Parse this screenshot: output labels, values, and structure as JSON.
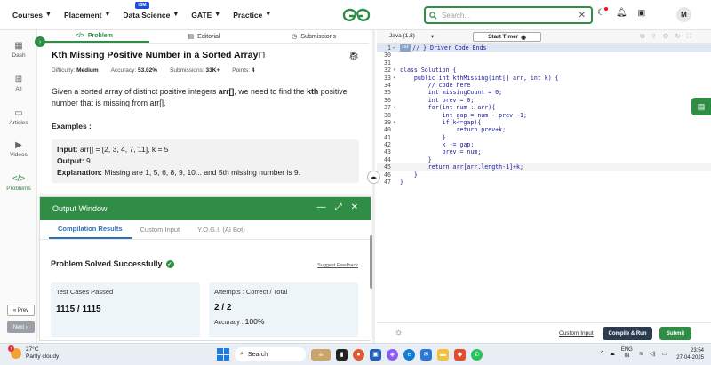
{
  "nav": {
    "items": [
      {
        "label": "Courses"
      },
      {
        "label": "Placement"
      },
      {
        "label": "Data Science",
        "badge": "IBM"
      },
      {
        "label": "GATE"
      },
      {
        "label": "Practice"
      }
    ],
    "search_placeholder": "Search...",
    "avatar_letter": "M",
    "brand_color": "#2f8d46"
  },
  "rail": {
    "items": [
      {
        "label": "Dash"
      },
      {
        "label": "All"
      },
      {
        "label": "Articles"
      },
      {
        "label": "Videos"
      },
      {
        "label": "Problems"
      }
    ],
    "prev": "« Prev",
    "next": "Next »"
  },
  "problem_tabs": {
    "problem": "Problem",
    "editorial": "Editorial",
    "submissions": "Submissions"
  },
  "problem": {
    "title": "Kth Missing Positive Number in a Sorted Array",
    "difficulty_label": "Difficulty:",
    "difficulty": "Medium",
    "accuracy_label": "Accuracy:",
    "accuracy": "53.02%",
    "submissions_label": "Submissions:",
    "submissions": "33K+",
    "points_label": "Points:",
    "points": "4",
    "desc_pre": "Given a sorted array of distinct positive integers ",
    "desc_arr": "arr[]",
    "desc_mid": ", we need to find the ",
    "desc_k": "kth",
    "desc_post": " positive number that is missing from arr[].",
    "examples_heading": "Examples :",
    "example": {
      "input_label": "Input:",
      "input": " arr[] = [2, 3, 4, 7, 11], k = 5",
      "output_label": "Output:",
      "output": " 9",
      "explanation_label": "Explanation:",
      "explanation": " Missing are 1, 5, 6, 8, 9, 10... and 5th missing number is 9."
    }
  },
  "output_window": {
    "title": "Output Window",
    "tabs": [
      "Compilation Results",
      "Custom Input",
      "Y.O.G.I. (AI Bot)"
    ],
    "status": "Problem Solved Successfully",
    "support": "Suggest Feedback",
    "test_cases_label": "Test Cases Passed",
    "test_cases": "1115 / 1115",
    "attempts_label": "Attempts : Correct / Total",
    "attempts": "2 / 2",
    "accuracy_label": "Accuracy :",
    "accuracy": "100%"
  },
  "editor": {
    "language": "Java (1.8)",
    "timer": "Start Timer",
    "lines": [
      {
        "n": "1",
        "fold": "▸",
        "text": "// } Driver Code Ends",
        "cls": "hl",
        "comment": true,
        "tag": "cmt"
      },
      {
        "n": "30",
        "fold": "",
        "text": ""
      },
      {
        "n": "31",
        "fold": "",
        "text": ""
      },
      {
        "n": "32",
        "fold": "▾",
        "text": "class Solution {"
      },
      {
        "n": "33",
        "fold": "▾",
        "text": "    public int kthMissing(int[] arr, int k) {"
      },
      {
        "n": "34",
        "fold": "",
        "text": "        // code here",
        "comment": true
      },
      {
        "n": "35",
        "fold": "",
        "text": "        int missingCount = 0;"
      },
      {
        "n": "36",
        "fold": "",
        "text": "        int prev = 0;"
      },
      {
        "n": "37",
        "fold": "▾",
        "text": "        for(int num : arr){"
      },
      {
        "n": "38",
        "fold": "",
        "text": "            int gap = num - prev -1;"
      },
      {
        "n": "39",
        "fold": "▾",
        "text": "            if(k<=gap){"
      },
      {
        "n": "40",
        "fold": "",
        "text": "                return prev+k;"
      },
      {
        "n": "41",
        "fold": "",
        "text": "            }"
      },
      {
        "n": "42",
        "fold": "",
        "text": "            k -= gap;"
      },
      {
        "n": "43",
        "fold": "",
        "text": "            prev = num;"
      },
      {
        "n": "44",
        "fold": "",
        "text": "        }"
      },
      {
        "n": "45",
        "fold": "",
        "text": "        return arr[arr.length-1]+k;",
        "cls": "hl2"
      },
      {
        "n": "46",
        "fold": "",
        "text": "    }"
      },
      {
        "n": "47",
        "fold": "",
        "text": "}"
      }
    ],
    "custom_input": "Custom Input",
    "compile": "Compile & Run",
    "submit": "Submit"
  },
  "taskbar": {
    "temp": "27°C",
    "weather": "Partly cloudy",
    "weather_badge": "7",
    "search": "Search",
    "lang_top": "ENG",
    "lang_bottom": "IN",
    "time": "23:54",
    "date": "27-04-2025"
  }
}
